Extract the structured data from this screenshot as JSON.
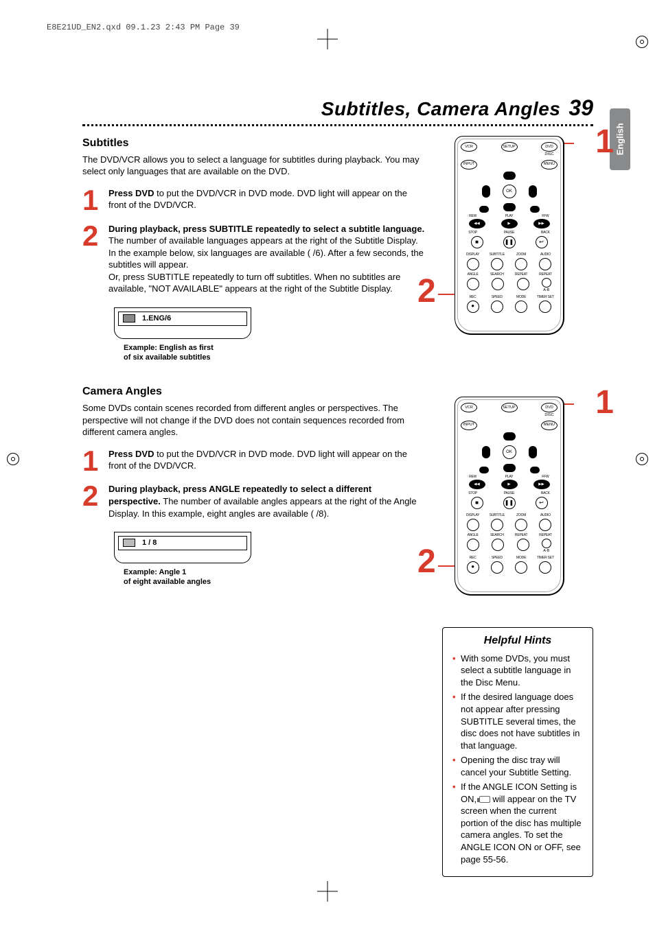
{
  "meta": {
    "header": "E8E21UD_EN2.qxd  09.1.23  2:43 PM  Page 39"
  },
  "title": {
    "text": "Subtitles, Camera Angles",
    "page_num": "39",
    "lang_tab": "English"
  },
  "subtitles": {
    "heading": "Subtitles",
    "intro": "The DVD/VCR allows you to select a language for subtitles during playback. You may select only languages that are available on the DVD.",
    "step1_bold": "Press DVD",
    "step1_rest": " to put the DVD/VCR in DVD mode. DVD light will appear on the front of the DVD/VCR.",
    "step2_bold": "During playback, press SUBTITLE repeatedly to select a subtitle language.",
    "step2_rest": " The number of available languages appears at the right of the Subtitle Display. In the example below, six languages are available ( /6). After a few seconds, the subtitles will appear.\nOr, press SUBTITLE repeatedly to turn off subtitles. When no subtitles are available, \"NOT AVAILABLE\" appears at the right of the Subtitle Display.",
    "osd_value": "1.ENG/6",
    "osd_caption_l1": "Example: English as first",
    "osd_caption_l2": "of six available subtitles"
  },
  "angles": {
    "heading": "Camera Angles",
    "intro": "Some DVDs contain scenes recorded from different angles or perspectives. The perspective will not change if the DVD does not contain sequences recorded from different camera angles.",
    "step1_bold": "Press DVD",
    "step1_rest": " to put the DVD/VCR in DVD mode. DVD light will appear on the front of the DVD/VCR.",
    "step2_bold": "During playback, press ANGLE repeatedly to select a different perspective.",
    "step2_rest": " The number of available angles appears at the right of the Angle Display. In this example, eight angles are available ( /8).",
    "osd_value": "1 / 8",
    "osd_caption_l1": "Example: Angle 1",
    "osd_caption_l2": "of eight available angles"
  },
  "remote": {
    "top": {
      "vcr": "VCR",
      "setup": "SETUP",
      "dvd": "DVD",
      "disc": "DISC",
      "input": "INPUT",
      "menu": "MENU"
    },
    "ok": "OK",
    "trans": {
      "rew": "REW",
      "play": "PLAY",
      "ffw": "FFW",
      "stop": "STOP",
      "pause": "PAUSE",
      "back": "BACK"
    },
    "row1": {
      "display": "DISPLAY",
      "subtitle": "SUBTITLE",
      "zoom": "ZOOM",
      "audio": "AUDIO"
    },
    "row2": {
      "angle": "ANGLE",
      "search": "SEARCH",
      "repeat": "REPEAT",
      "repeat_ab": "REPEAT",
      "ab": "A-B"
    },
    "row3": {
      "rec": "REC",
      "speed": "SPEED",
      "mode": "MODE",
      "timerset": "TIMER SET"
    },
    "rec_dot": "●"
  },
  "hints": {
    "heading": "Helpful Hints",
    "items": [
      "With some DVDs, you must select a subtitle language in the Disc Menu.",
      "If the desired language does not appear after pressing SUBTITLE several times, the disc does not have subtitles in that language.",
      "Opening the disc tray will cancel your Subtitle Setting.",
      "If the ANGLE ICON Setting is ON,  ⎡cam⎦ will appear on the TV screen when the current portion of the disc has multiple camera angles. To set the ANGLE ICON ON or OFF, see page 55-56."
    ],
    "item4_pre": "If the ANGLE ICON Setting is ON, ",
    "item4_post": " will appear on the TV screen when the current portion of the disc has multiple camera angles. To set the ANGLE ICON ON or OFF, see page 55-56."
  },
  "chart_data": {
    "type": "table",
    "title": "On-screen display examples",
    "rows": [
      {
        "feature": "Subtitle",
        "display": "1.ENG/6",
        "current": 1,
        "total": 6,
        "label": "ENG"
      },
      {
        "feature": "Angle",
        "display": "1 / 8",
        "current": 1,
        "total": 8
      }
    ]
  }
}
